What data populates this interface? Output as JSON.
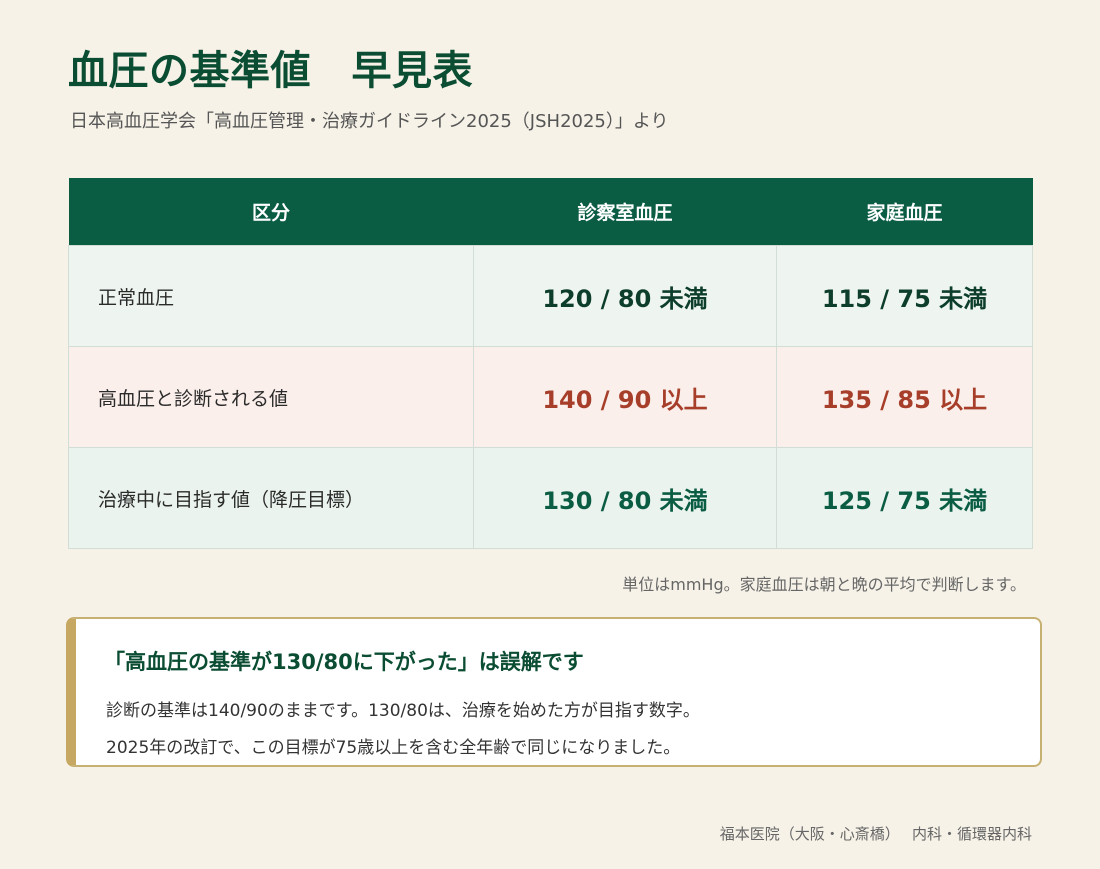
{
  "header": {
    "title": "血圧の基準値　早見表",
    "subtitle": "日本高血圧学会「高血圧管理・治療ガイドライン2025（JSH2025）」より"
  },
  "table": {
    "columns": [
      "区分",
      "診察室血圧",
      "家庭血圧"
    ],
    "rows": [
      {
        "label": "正常血圧",
        "office": "120 / 80 未満",
        "home": "115 / 75 未満"
      },
      {
        "label": "高血圧と診断される値",
        "office": "140 / 90 以上",
        "home": "135 / 85 以上"
      },
      {
        "label": "治療中に目指す値（降圧目標）",
        "office": "130 / 80 未満",
        "home": "125 / 75 未満"
      }
    ]
  },
  "note": "単位はmmHg。家庭血圧は朝と晩の平均で判断します。",
  "callout": {
    "title": "「高血圧の基準が130/80に下がった」は誤解です",
    "lines": [
      "診断の基準は140/90のままです。130/80は、治療を始めた方が目指す数字。",
      "2025年の改訂で、この目標が75歳以上を含む全年齢で同じになりました。"
    ]
  },
  "footer": "福本医院（大阪・心斎橋）　 内科・循環器内科",
  "colors": {
    "background": "#f6f2e8",
    "header_green": "#0a5c43",
    "title_green": "#0b4d33",
    "normal_value": "#0d3d2b",
    "hypertension_value": "#a63e2a",
    "target_value": "#0a5c43",
    "accent_gold": "#c7a862"
  }
}
